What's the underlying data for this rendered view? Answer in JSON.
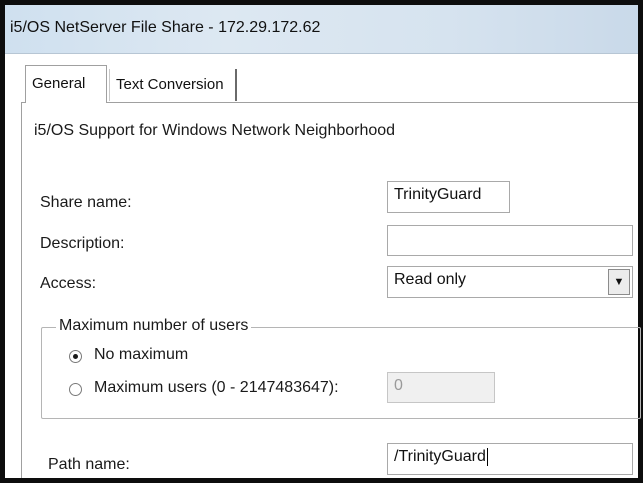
{
  "window": {
    "title": "i5/OS NetServer File Share - 172.29.172.62"
  },
  "tabs": [
    {
      "label": "General",
      "selected": true
    },
    {
      "label": "Text Conversion",
      "selected": false
    }
  ],
  "general": {
    "description_text": "i5/OS Support for Windows Network Neighborhood",
    "share_name": {
      "label": "Share name:",
      "value": "TrinityGuard"
    },
    "description": {
      "label": "Description:",
      "value": ""
    },
    "access": {
      "label": "Access:",
      "value": "Read only"
    },
    "max_users_group": {
      "legend": "Maximum number of users",
      "no_maximum": {
        "label": "No maximum",
        "checked": true
      },
      "maximum_users": {
        "label": "Maximum users (0 - 2147483647):",
        "checked": false,
        "value": "0"
      }
    },
    "path_name": {
      "label": "Path name:",
      "value": "/TrinityGuard"
    }
  }
}
